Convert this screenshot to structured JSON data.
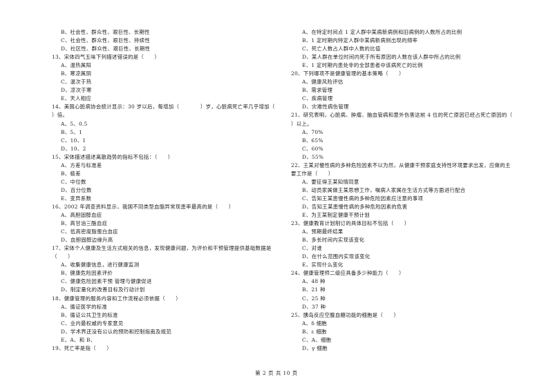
{
  "left": [
    {
      "t": "opt",
      "text": "B、社会性、群众性、艰巨性、长期性"
    },
    {
      "t": "opt",
      "text": "C、社会性、群众性、艰巨性、持续性"
    },
    {
      "t": "opt",
      "text": "D、社区性、群众性、艰巨性、长期性"
    },
    {
      "t": "q",
      "text": "13、宋体四气五味下列描述错误的是（　　）"
    },
    {
      "t": "opt",
      "text": "A、温热属阳"
    },
    {
      "t": "opt",
      "text": "B、寒凉属阴"
    },
    {
      "t": "opt",
      "text": "C、温次于热"
    },
    {
      "t": "opt",
      "text": "D、凉次于寒"
    },
    {
      "t": "opt",
      "text": "E、天人相应"
    },
    {
      "t": "q",
      "text": "14、美国心脏病协会统计显示：30 岁以后，每增加（　　　　）岁，心脏病死亡率几乎增加（"
    },
    {
      "t": "q",
      "text": "）倍。"
    },
    {
      "t": "opt",
      "text": "A、5、0.5"
    },
    {
      "t": "opt",
      "text": "B、5、1"
    },
    {
      "t": "opt",
      "text": "C、10、1"
    },
    {
      "t": "opt",
      "text": "D、10、2"
    },
    {
      "t": "q",
      "text": "15、宋体描述描述离散趋势的指标不包括：（　　）"
    },
    {
      "t": "opt",
      "text": "A、方差与标准差"
    },
    {
      "t": "opt",
      "text": "B、极差"
    },
    {
      "t": "opt",
      "text": "C、中位数"
    },
    {
      "t": "opt",
      "text": "D、百分位数"
    },
    {
      "t": "opt",
      "text": "E、变异系数"
    },
    {
      "t": "q",
      "text": "16、2002 年调查资料显示，我国不同类型血脂异常现患率最高的是（　　）"
    },
    {
      "t": "opt",
      "text": "A、高胆固醇血症"
    },
    {
      "t": "opt",
      "text": "B、高甘油三酯血症"
    },
    {
      "t": "opt",
      "text": "C、低高密度脂蛋白血症"
    },
    {
      "t": "opt",
      "text": "D、血胆固醇边缘升高"
    },
    {
      "t": "q",
      "text": "17、宋体个人健康及生活方式相关的信息，发现健康问题，为评价和干预管理提供基础数据是"
    },
    {
      "t": "q",
      "text": "（　　）"
    },
    {
      "t": "opt",
      "text": "A、收集健康信息，进行健康监测"
    },
    {
      "t": "opt",
      "text": "B、健康危险因素评价"
    },
    {
      "t": "opt",
      "text": "C、健康危险因素干预 管理与健康促进"
    },
    {
      "t": "opt",
      "text": "D、制定量化的改善目标及行动计划"
    },
    {
      "t": "q",
      "text": "18、健康管理的服务内容和工作流程必须依据（　　）"
    },
    {
      "t": "opt",
      "text": "A、循证医学的标准"
    },
    {
      "t": "opt",
      "text": "B、循证公共卫生的标准"
    },
    {
      "t": "opt",
      "text": "C、业内最权威的专家意见"
    },
    {
      "t": "opt",
      "text": "D、学术界还没有公认的预防和控制指南及规范"
    },
    {
      "t": "opt",
      "text": "E、A、和 B、"
    },
    {
      "t": "q",
      "text": "19、死亡率是指（　　）"
    }
  ],
  "right": [
    {
      "t": "opt",
      "text": "A、在特定时间点 1 定人群中某病新病例和旧病例的人数所占的比例"
    },
    {
      "t": "opt",
      "text": "B、1 定时期内特定人群中某病新病例出现的频率"
    },
    {
      "t": "opt",
      "text": "C、死亡人数占人群中人数的比值"
    },
    {
      "t": "opt",
      "text": "D、某人群在单位时间内死于所有原因的人数在该人群中所占的比例"
    },
    {
      "t": "opt",
      "text": "E、1 定时期内患处非的全部患者中该病死亡的比例"
    },
    {
      "t": "q",
      "text": "20、下列哪项不是健康管理的基本策略（　　）"
    },
    {
      "t": "opt",
      "text": "A、健康风险评估"
    },
    {
      "t": "opt",
      "text": "B、需求管理"
    },
    {
      "t": "opt",
      "text": "C、疾病管理"
    },
    {
      "t": "opt",
      "text": "D、灾难性病伤管理"
    },
    {
      "t": "q",
      "text": "21、研究表明，心脏病、肿瘤、脑血管病和意外伤害这前 4 位的死亡原因已经占死亡原因的（"
    },
    {
      "t": "q",
      "text": "）以上。"
    },
    {
      "t": "opt",
      "text": "A、70%"
    },
    {
      "t": "opt",
      "text": "B、65%"
    },
    {
      "t": "opt",
      "text": "C、60%"
    },
    {
      "t": "opt",
      "text": "D、55%"
    },
    {
      "t": "q",
      "text": "22、王某对慢性病的多种危险因素不以为然，从健康干预家庭支持性环境要求出发，应做的主"
    },
    {
      "t": "q",
      "text": "要工作是（　　）"
    },
    {
      "t": "opt",
      "text": "A、要征得王某知情同意"
    },
    {
      "t": "opt",
      "text": "B、动员家属做王某思想工作，嘱病人家属在生活方式等方面进行配合"
    },
    {
      "t": "opt",
      "text": "C、告知王某患慢性病的多种危险因素应注意的事项"
    },
    {
      "t": "opt",
      "text": "D、告知王某患慢性病的多种危险因素的危害"
    },
    {
      "t": "opt",
      "text": "E、为王某制定健康干预计划"
    },
    {
      "t": "q",
      "text": "23、健康教育计划制订的具体目标不包括（　　）"
    },
    {
      "t": "opt",
      "text": "A、预期最终结果"
    },
    {
      "t": "opt",
      "text": "B、多长时间内实现该变化"
    },
    {
      "t": "opt",
      "text": "C、对谁"
    },
    {
      "t": "opt",
      "text": "D、在什么范围内实现该变化"
    },
    {
      "t": "opt",
      "text": "E、实现什么变化"
    },
    {
      "t": "q",
      "text": "24、健康管理师二级应具备多少种能力（　　）"
    },
    {
      "t": "opt",
      "text": "A、48 种"
    },
    {
      "t": "opt",
      "text": "B、21 种"
    },
    {
      "t": "opt",
      "text": "C、25 种"
    },
    {
      "t": "opt",
      "text": "D、37 种"
    },
    {
      "t": "q",
      "text": "25、胰岛反应空腹血糖功能的细胞是（　　）"
    },
    {
      "t": "opt",
      "text": "A、δ 细胞"
    },
    {
      "t": "opt",
      "text": "B、ε 细胞"
    },
    {
      "t": "opt",
      "text": "C、A、细胞"
    },
    {
      "t": "opt",
      "text": "D、γ 细胞"
    }
  ],
  "footer": {
    "page_label": "第 2 页 共 10 页"
  }
}
